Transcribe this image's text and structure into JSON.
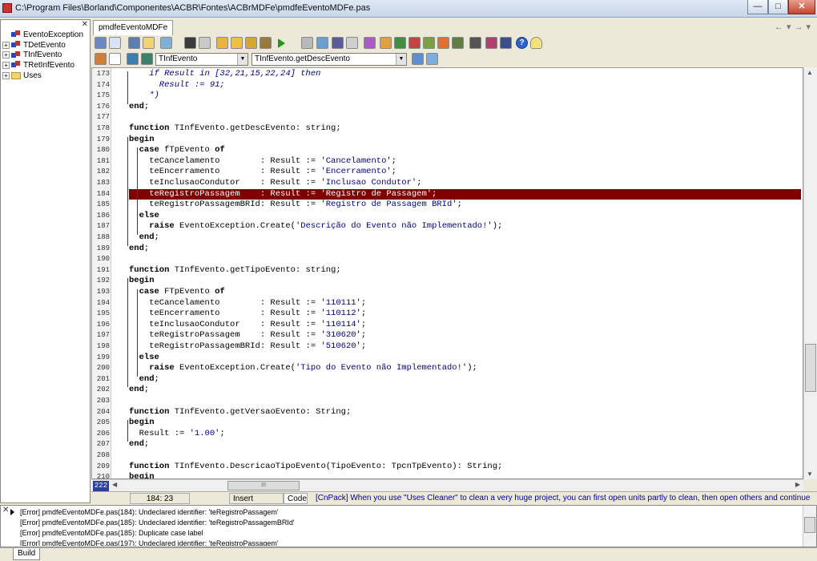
{
  "window": {
    "title": "C:\\Program Files\\Borland\\Componentes\\ACBR\\Fontes\\ACBrMDFe\\pmdfeEventoMDFe.pas",
    "buttons": [
      "—",
      "□",
      "✕"
    ]
  },
  "tree": {
    "items": [
      {
        "label": "EventoException",
        "expandable": false,
        "type": "class"
      },
      {
        "label": "TDetEvento",
        "expandable": true,
        "type": "class"
      },
      {
        "label": "TInfEvento",
        "expandable": true,
        "type": "class"
      },
      {
        "label": "TRetInfEvento",
        "expandable": true,
        "type": "class"
      },
      {
        "label": "Uses",
        "expandable": true,
        "type": "folder"
      }
    ]
  },
  "tabs": {
    "active": "pmdfeEventoMDFe"
  },
  "toolbar2": {
    "class_combo": "TInfEvento",
    "method_combo": "TInfEvento.getDescEvento"
  },
  "editor": {
    "highlight_line": 184,
    "lines": [
      {
        "n": "173",
        "t": "    if Result in [32,21,15,22,24] then"
      },
      {
        "n": "174",
        "t": "      Result := 91;"
      },
      {
        "n": "175",
        "t": "    *)"
      },
      {
        "n": "176",
        "t": "end;"
      },
      {
        "n": "177",
        "t": ""
      },
      {
        "n": "178",
        "t": "function TInfEvento.getDescEvento: string;"
      },
      {
        "n": "179",
        "t": "begin"
      },
      {
        "n": "180",
        "t": "  case fTpEvento of"
      },
      {
        "n": "181",
        "t": "    teCancelamento        : Result := 'Cancelamento';"
      },
      {
        "n": "182",
        "t": "    teEncerramento        : Result := 'Encerramento';"
      },
      {
        "n": "183",
        "t": "    teInclusaoCondutor    : Result := 'Inclusao Condutor';"
      },
      {
        "n": "184",
        "t": "    teRegistroPassagem    : Result := 'Registro de Passagem';"
      },
      {
        "n": "185",
        "t": "    teRegistroPassagemBRId: Result := 'Registro de Passagem BRId';"
      },
      {
        "n": "186",
        "t": "  else"
      },
      {
        "n": "187",
        "t": "    raise EventoException.Create('Descrição do Evento não Implementado!');"
      },
      {
        "n": "188",
        "t": "  end;"
      },
      {
        "n": "189",
        "t": "end;"
      },
      {
        "n": "190",
        "t": ""
      },
      {
        "n": "191",
        "t": "function TInfEvento.getTipoEvento: string;"
      },
      {
        "n": "192",
        "t": "begin"
      },
      {
        "n": "193",
        "t": "  case FTpEvento of"
      },
      {
        "n": "194",
        "t": "    teCancelamento        : Result := '110111';"
      },
      {
        "n": "195",
        "t": "    teEncerramento        : Result := '110112';"
      },
      {
        "n": "196",
        "t": "    teInclusaoCondutor    : Result := '110114';"
      },
      {
        "n": "197",
        "t": "    teRegistroPassagem    : Result := '310620';"
      },
      {
        "n": "198",
        "t": "    teRegistroPassagemBRId: Result := '510620';"
      },
      {
        "n": "199",
        "t": "  else"
      },
      {
        "n": "200",
        "t": "    raise EventoException.Create('Tipo do Evento não Implementado!');"
      },
      {
        "n": "201",
        "t": "  end;"
      },
      {
        "n": "202",
        "t": "end;"
      },
      {
        "n": "203",
        "t": ""
      },
      {
        "n": "204",
        "t": "function TInfEvento.getVersaoEvento: String;"
      },
      {
        "n": "205",
        "t": "begin"
      },
      {
        "n": "206",
        "t": "  Result := '1.00';"
      },
      {
        "n": "207",
        "t": "end;"
      },
      {
        "n": "208",
        "t": ""
      },
      {
        "n": "209",
        "t": "function TInfEvento.DescricaoTipoEvento(TipoEvento: TpcnTpEvento): String;"
      },
      {
        "n": "210",
        "t": "begin"
      }
    ]
  },
  "hscroll": {
    "line_badge": "222",
    "thumb_label": "III"
  },
  "status": {
    "position": "184: 23",
    "mode": "Insert",
    "view_tab": "Code",
    "hint": "[CnPack] When you use \"Uses Cleaner\" to clean a very huge project, you can first open units partly to clean, then open others and continue until all done."
  },
  "messages": [
    "[Error] pmdfeEventoMDFe.pas(184): Undeclared identifier: 'teRegistroPassagem'",
    "[Error] pmdfeEventoMDFe.pas(185): Undeclared identifier: 'teRegistroPassagemBRId'",
    "[Error] pmdfeEventoMDFe.pas(185): Duplicate case label",
    "[Error] pmdfeEventoMDFe.pas(197): Undeclared identifier: 'teRegistroPassagem'"
  ],
  "bottom_tabs": {
    "build": "Build"
  },
  "colors": {
    "highlight_line_bg": "#800000",
    "line_badge_bg": "#2a3f9e",
    "hint_text": "#0000aa"
  }
}
